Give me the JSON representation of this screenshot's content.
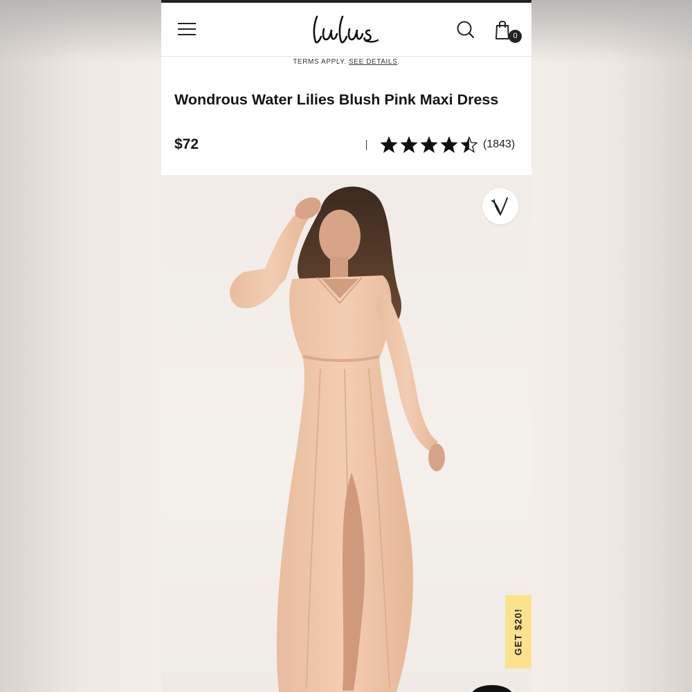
{
  "header": {
    "logo_text": "Lulus",
    "cart_count": "0",
    "icons": [
      "menu-icon",
      "search-icon",
      "shopping-bag-icon"
    ]
  },
  "promo": {
    "text": "TERMS APPLY. ",
    "link": "SEE DETAILS",
    "suffix": "."
  },
  "product": {
    "title": "Wondrous Water Lilies Blush Pink Maxi Dress",
    "price": "$72",
    "rating": 4.5,
    "rating_max": 5,
    "review_count": "(1843)"
  },
  "actions": {
    "favorite_icon": "heart-icon",
    "reward_label": "GET $20!"
  },
  "colors": {
    "accent_yellow": "#fde28e",
    "dress_blush": "#f0c9ac",
    "text_dark": "#141414"
  }
}
